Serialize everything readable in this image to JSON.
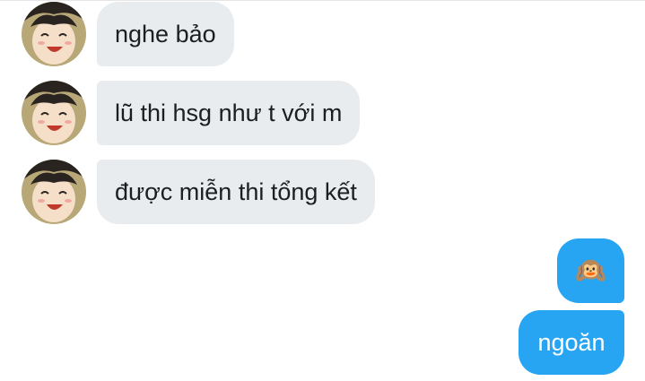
{
  "conversation": {
    "incoming": [
      {
        "text": "nghe bảo"
      },
      {
        "text": "lũ thi hsg như t với m"
      },
      {
        "text": "được miễn thi tổng kết"
      }
    ],
    "outgoing": [
      {
        "emoji": "🙉",
        "icon": "hear-no-evil-monkey-emoji"
      },
      {
        "text": "ngoăn"
      }
    ]
  },
  "colors": {
    "incoming_bubble": "#e9ecef",
    "incoming_text": "#1c1e21",
    "outgoing_bubble": "#27a5f3",
    "outgoing_text": "#ffffff"
  }
}
